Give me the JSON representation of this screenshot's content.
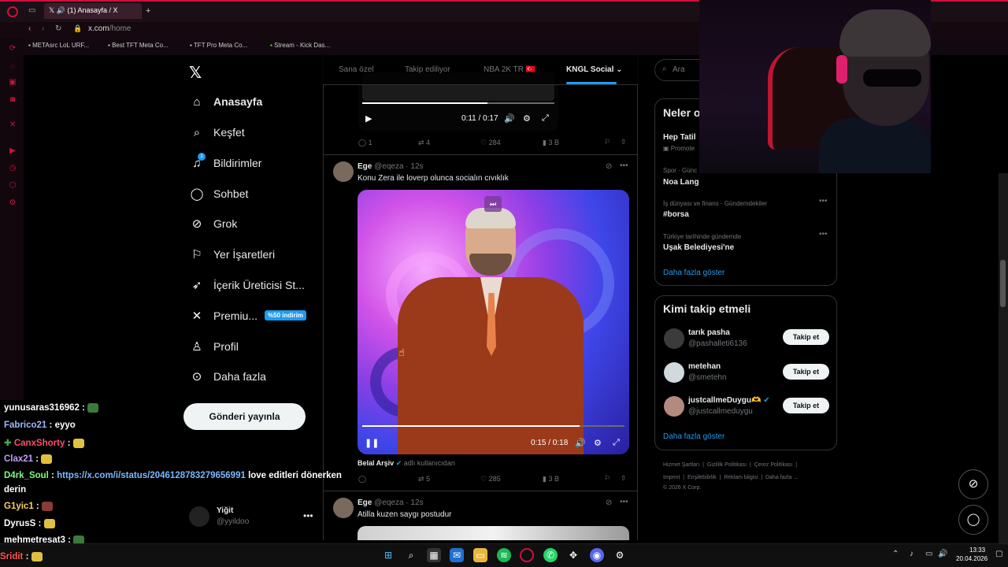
{
  "browser": {
    "tab_title": "(1) Anasayfa / X",
    "url_host": "x.com",
    "url_path": "/home",
    "bookmarks": [
      "METAsrc LoL URF...",
      "Best TFT Meta Co...",
      "TFT Pro Meta Co...",
      "Stream - Kick Das..."
    ]
  },
  "sidebar": {
    "items": [
      {
        "label": "Anasayfa",
        "icon": "home-icon"
      },
      {
        "label": "Keşfet",
        "icon": "search-icon"
      },
      {
        "label": "Bildirimler",
        "icon": "bell-icon"
      },
      {
        "label": "Sohbet",
        "icon": "chat-icon"
      },
      {
        "label": "Grok",
        "icon": "grok-icon"
      },
      {
        "label": "Yer İşaretleri",
        "icon": "bookmark-icon"
      },
      {
        "label": "İçerik Üreticisi St...",
        "icon": "rocket-icon"
      },
      {
        "label": "Premiu...",
        "icon": "x-icon"
      },
      {
        "label": "Profil",
        "icon": "person-icon"
      },
      {
        "label": "Daha fazla",
        "icon": "more-icon"
      }
    ],
    "notif_count": "1",
    "premium_badge": "%50 indirim",
    "post_button": "Gönderi yayınla",
    "account": {
      "name": "Yiğit",
      "handle": "@yyildoo"
    }
  },
  "feed": {
    "tabs": [
      "Sana özel",
      "Takip ediliyor",
      "NBA 2K TR 🇹🇷",
      "KNGL Social"
    ],
    "tweet1": {
      "video_time": "0:11 / 0:17",
      "progress": 0.65,
      "reply": "1",
      "retweet": "4",
      "like": "284",
      "views": "3 B"
    },
    "tweet2": {
      "name": "Ege",
      "handle": "@eqeza · 12s",
      "text": "Konu Zera ile loverp olunca socialın cıvıklık",
      "video_time": "0:15 / 0:18",
      "progress": 0.83,
      "source_name": "Belal Arşiv",
      "source_note": "adlı kullanıcıdan",
      "reply": "",
      "retweet": "5",
      "like": "285",
      "views": "3 B"
    },
    "tweet3": {
      "name": "Ege",
      "handle": "@eqeza · 12s",
      "text": "Atilla kuzen saygı postudur"
    }
  },
  "right": {
    "search_placeholder": "Ara",
    "trends_title": "Neler o",
    "trends": [
      {
        "meta": "Promote",
        "title": "Hep Tatil"
      },
      {
        "meta": "Spor · Günc",
        "title": "Noa Lang"
      },
      {
        "meta": "İş dünyası ve finans · Gündemdekiler",
        "title": "#borsa"
      },
      {
        "meta": "Türkiye tarihinde gündemde",
        "title": "Uşak Belediyesi'ne"
      }
    ],
    "show_more": "Daha fazla göster",
    "wtf_title": "Kimi takip etmeli",
    "wtf": [
      {
        "name": "tarık pasha",
        "handle": "@pashalleti6136"
      },
      {
        "name": "metehan",
        "handle": "@smetehn"
      },
      {
        "name": "justcallmeDuygu🫶",
        "handle": "@justcallmeduygu"
      }
    ],
    "follow_label": "Takip et",
    "footer_line1": [
      "Hizmet Şartları",
      "Gizlilik Politikası",
      "Çerez Politikası"
    ],
    "footer_line2": [
      "Imprint",
      "Erişilebilirlik",
      "Reklam bilgisi",
      "Daha fazla ..."
    ],
    "copyright": "© 2026 X Corp."
  },
  "chat": [
    {
      "user": "yunusaras316962",
      "msg": "",
      "color": "#ffffff"
    },
    {
      "user": "Fabrico21",
      "msg": "eyyo",
      "color": "#9fb7ff"
    },
    {
      "user": "CanxShorty",
      "msg": "",
      "color": "#ff4d6d"
    },
    {
      "user": "Clax21",
      "msg": "",
      "color": "#c39bff"
    },
    {
      "user": "D4rk_Soul",
      "msg": "https://x.com/i/status/2046128783279656991",
      "msg2": "love editleri dönerken",
      "msg3": "derin",
      "color": "#7cfc7c"
    },
    {
      "user": "G1yic1",
      "msg": "",
      "color": "#ffcc66"
    },
    {
      "user": "DyrusS",
      "msg": "",
      "color": "#ffffff"
    },
    {
      "user": "mehmetresat3",
      "msg": "",
      "color": "#ffffff"
    },
    {
      "user": "Sridit",
      "msg": "",
      "color": "#ff5555"
    }
  ],
  "taskbar": {
    "time": "13:33",
    "date": "20.04.2026"
  }
}
